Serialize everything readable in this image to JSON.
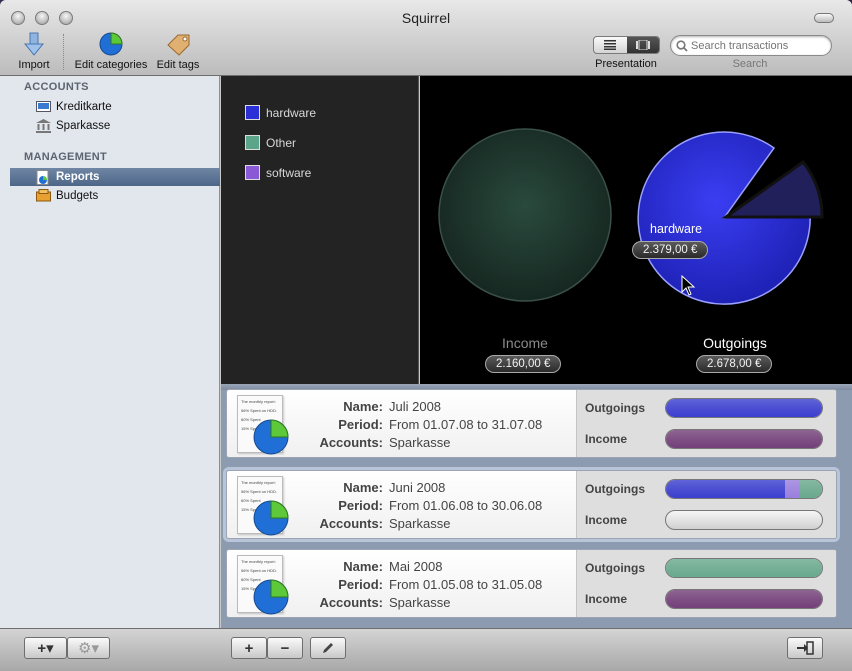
{
  "window": {
    "title": "Squirrel"
  },
  "toolbar": {
    "import_label": "Import",
    "edit_categories_label": "Edit categories",
    "edit_tags_label": "Edit tags",
    "presentation_label": "Presentation",
    "search_label": "Search",
    "search_placeholder": "Search transactions"
  },
  "sidebar": {
    "accounts_header": "ACCOUNTS",
    "accounts": [
      {
        "label": "Kreditkarte",
        "icon": "credit-card-icon"
      },
      {
        "label": "Sparkasse",
        "icon": "bank-icon"
      }
    ],
    "management_header": "MANAGEMENT",
    "management": [
      {
        "label": "Reports",
        "icon": "report-icon",
        "selected": true
      },
      {
        "label": "Budgets",
        "icon": "budget-icon",
        "selected": false
      }
    ]
  },
  "legend": [
    {
      "label": "hardware",
      "color": "#2b2fd6"
    },
    {
      "label": "Other",
      "color": "#5da58a"
    },
    {
      "label": "software",
      "color": "#8a5ad6"
    }
  ],
  "charts": {
    "income": {
      "label": "Income",
      "value": "2.160,00 €"
    },
    "outgoings": {
      "label": "Outgoings",
      "value": "2.678,00 €"
    },
    "hover": {
      "label": "hardware",
      "value": "2.379,00 €"
    }
  },
  "reports": [
    {
      "name_key": "Name:",
      "name": "Juli 2008",
      "period_key": "Period:",
      "period": "From 01.07.08 to 31.07.08",
      "accounts_key": "Accounts:",
      "accounts": "Sparkasse",
      "outgoings_label": "Outgoings",
      "income_label": "Income",
      "outgoings_bar": [
        {
          "color": "#3b3fd0",
          "fraction": 1.0
        }
      ],
      "income_bar": [
        {
          "color": "#74407a",
          "fraction": 1.0
        }
      ]
    },
    {
      "name_key": "Name:",
      "name": "Juni 2008",
      "period_key": "Period:",
      "period": "From 01.06.08 to 30.06.08",
      "accounts_key": "Accounts:",
      "accounts": "Sparkasse",
      "outgoings_label": "Outgoings",
      "income_label": "Income",
      "outgoings_bar": [
        {
          "color": "#3b3fd0",
          "fraction": 0.76
        },
        {
          "color": "#9a80de",
          "fraction": 0.09
        },
        {
          "color": "#6aaa8e",
          "fraction": 0.15
        }
      ],
      "income_bar": []
    },
    {
      "name_key": "Name:",
      "name": "Mai 2008",
      "period_key": "Period:",
      "period": "From 01.05.08 to 31.05.08",
      "accounts_key": "Accounts:",
      "accounts": "Sparkasse",
      "outgoings_label": "Outgoings",
      "income_label": "Income",
      "outgoings_bar": [
        {
          "color": "#6aaa8e",
          "fraction": 1.0
        }
      ],
      "income_bar": [
        {
          "color": "#74407a",
          "fraction": 1.0
        }
      ]
    }
  ],
  "thumb_lines": [
    "The monthly report:",
    "56% Spent on HDD.",
    "60% Spent",
    "15% Spent"
  ]
}
